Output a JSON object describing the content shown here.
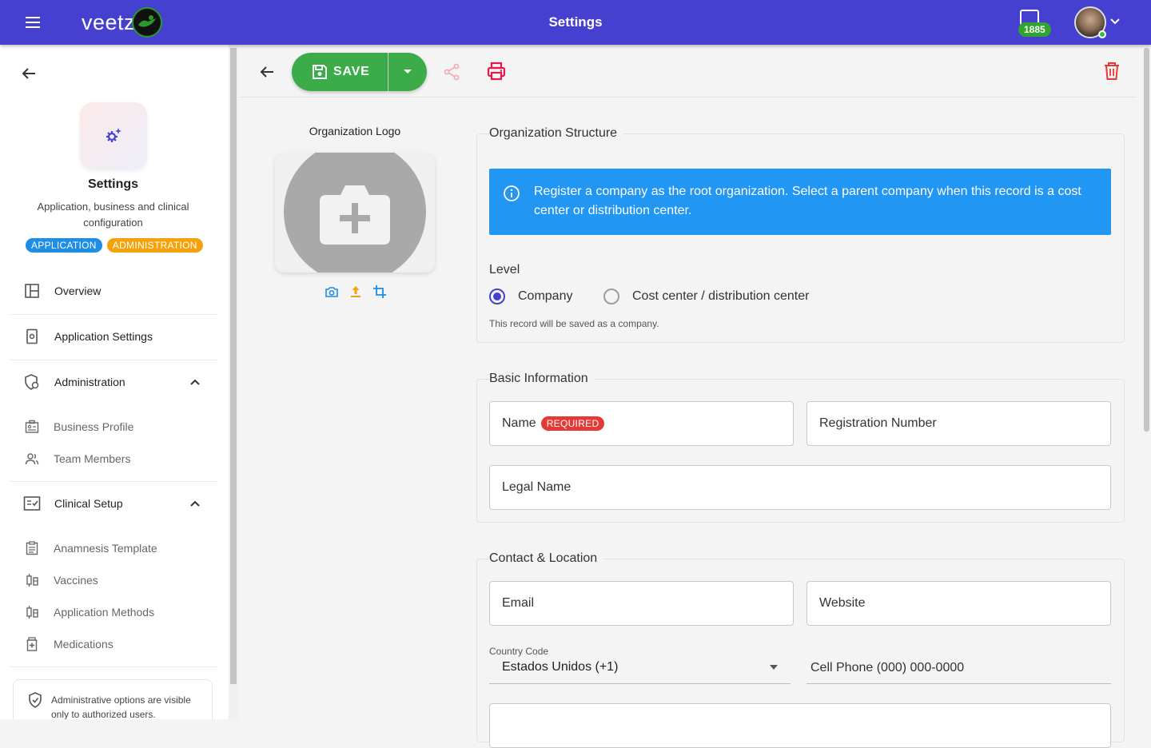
{
  "header": {
    "title": "Settings",
    "logo_text": "veetz",
    "message_count": "1885",
    "brand_color": "#4640d0"
  },
  "sidebar": {
    "app_title": "Settings",
    "app_description": "Application, business and clinical configuration",
    "badges": [
      "APPLICATION",
      "ADMINISTRATION"
    ],
    "items": [
      {
        "label": "Overview",
        "icon": "layout-icon"
      },
      {
        "label": "Application Settings",
        "icon": "settings-doc-icon"
      },
      {
        "label": "Administration",
        "icon": "shield-user-icon",
        "expanded": true
      },
      {
        "label": "Business Profile",
        "icon": "id-card-icon"
      },
      {
        "label": "Team Members",
        "icon": "people-icon"
      },
      {
        "label": "Clinical Setup",
        "icon": "checklist-icon",
        "expanded": true
      },
      {
        "label": "Anamnesis Template",
        "icon": "clipboard-icon"
      },
      {
        "label": "Vaccines",
        "icon": "syringe-icon"
      },
      {
        "label": "Application Methods",
        "icon": "syringe-icon"
      },
      {
        "label": "Medications",
        "icon": "medicine-icon"
      }
    ],
    "note": "Administrative options are visible only to authorized users."
  },
  "toolbar": {
    "save_label": "SAVE",
    "save_color": "#3bac49",
    "print_color": "#e5194b",
    "delete_color": "#e53935"
  },
  "logo_panel": {
    "label": "Organization Logo"
  },
  "org_structure": {
    "legend": "Organization Structure",
    "info": "Register a company as the root organization. Select a parent company when this record is a cost center or distribution center.",
    "level_label": "Level",
    "options": [
      "Company",
      "Cost center / distribution center"
    ],
    "selected": "Company",
    "hint": "This record will be saved as a company."
  },
  "basic_info": {
    "legend": "Basic Information",
    "name_label": "Name",
    "required_tag": "REQUIRED",
    "registration_label": "Registration Number",
    "legal_name_label": "Legal Name"
  },
  "contact": {
    "legend": "Contact & Location",
    "email_label": "Email",
    "website_label": "Website",
    "country_code_label": "Country Code",
    "country_code_value": "Estados Unidos (+1)",
    "cell_phone_label": "Cell Phone (000) 000-0000"
  }
}
